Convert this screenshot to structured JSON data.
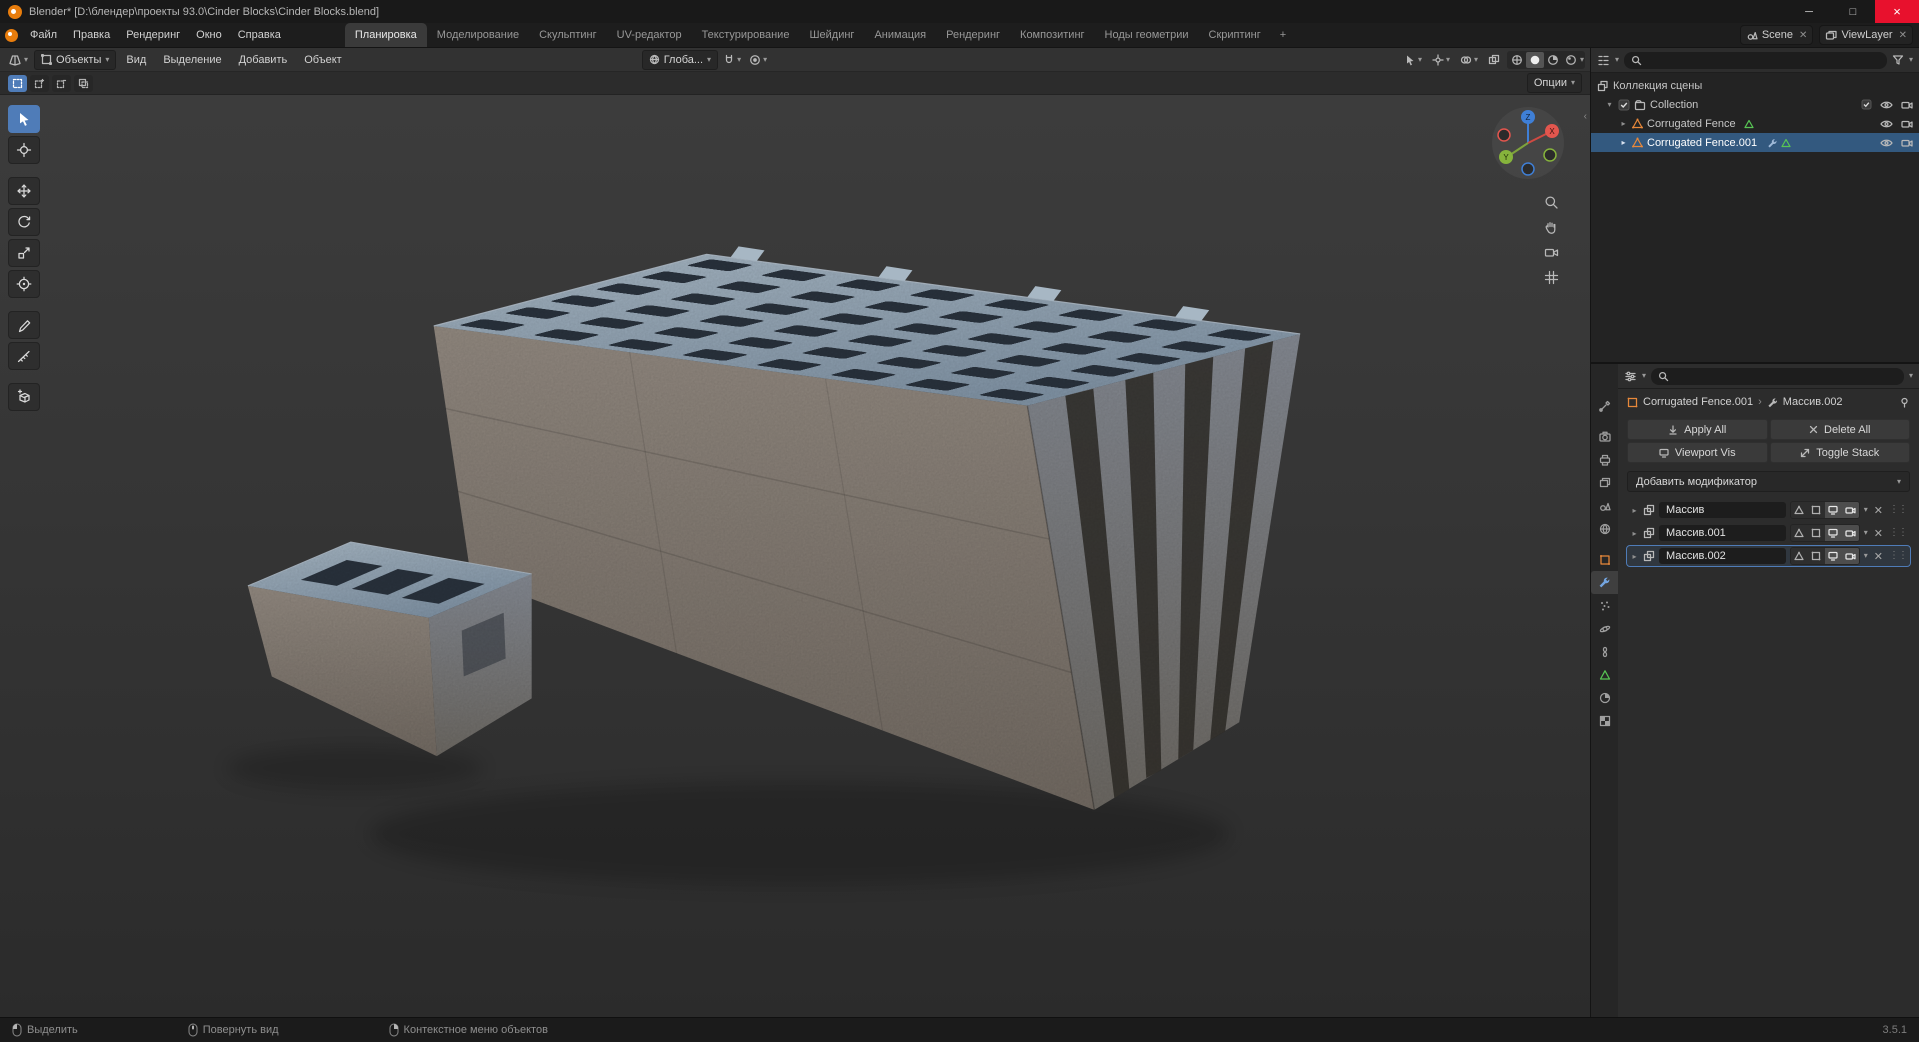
{
  "window": {
    "title": "Blender* [D:\\блендер\\проекты 93.0\\Cinder Blocks\\Cinder Blocks.blend]"
  },
  "topbar": {
    "menus": [
      "Файл",
      "Правка",
      "Рендеринг",
      "Окно",
      "Справка"
    ],
    "tabs": [
      "Планировка",
      "Моделирование",
      "Скульптинг",
      "UV-редактор",
      "Текстурирование",
      "Шейдинг",
      "Анимация",
      "Рендеринг",
      "Композитинг",
      "Ноды геометрии",
      "Скриптинг"
    ],
    "active_tab": "Планировка",
    "new_tab": "+",
    "scene": "Scene",
    "view_layer": "ViewLayer"
  },
  "viewport": {
    "header": {
      "mode_label": "Объекты",
      "menus": [
        "Вид",
        "Выделение",
        "Добавить",
        "Объект"
      ],
      "orientation": "Глоба..."
    },
    "tool_settings": {
      "options_label": "Опции"
    }
  },
  "outliner": {
    "scene_collection": "Коллекция сцены",
    "rows": [
      {
        "label": "Collection"
      },
      {
        "label": "Corrugated Fence"
      },
      {
        "label": "Corrugated Fence.001",
        "selected": true
      }
    ]
  },
  "properties": {
    "breadcrumb": {
      "object": "Corrugated Fence.001",
      "modifier": "Массив.002"
    },
    "tools": {
      "apply_all": "Apply All",
      "delete_all": "Delete All",
      "viewport_vis": "Viewport Vis",
      "toggle_stack": "Toggle Stack"
    },
    "add_modifier": "Добавить модификатор",
    "modifiers": [
      {
        "name": "Массив"
      },
      {
        "name": "Массив.001"
      },
      {
        "name": "Массив.002",
        "selected": true
      }
    ]
  },
  "statusbar": {
    "hints": [
      {
        "label": "Выделить"
      },
      {
        "label": "Повернуть вид"
      },
      {
        "label": "Контекстное меню объектов"
      }
    ],
    "version": "3.5.1"
  },
  "colors": {
    "accent": "#4f7cb8",
    "selection": "#33597f",
    "object_orange": "#e8883a",
    "data_green": "#58c554",
    "close_red": "#e8112d"
  }
}
